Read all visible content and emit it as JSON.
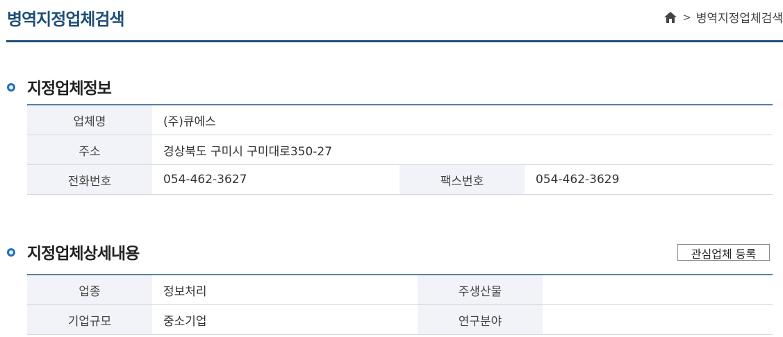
{
  "header": {
    "title": "병역지정업체검색",
    "breadcrumb": {
      "home_icon": "home-icon",
      "separator": ">",
      "current": "병역지정업체검색"
    }
  },
  "colors": {
    "brand": "#1f4e79",
    "label_bg": "#f1f3f8",
    "border": "#d5d9de"
  },
  "info_section": {
    "title": "지정업체정보",
    "company_label": "업체명",
    "company_value": "(주)큐에스",
    "address_label": "주소",
    "address_value": "경상북도 구미시 구미대로350-27",
    "phone_label": "전화번호",
    "phone_value": "054-462-3627",
    "fax_label": "팩스번호",
    "fax_value": "054-462-3629"
  },
  "detail_section": {
    "title": "지정업체상세내용",
    "watch_button": "관심업체 등록",
    "industry_label": "업종",
    "industry_value": "정보처리",
    "product_label": "주생산물",
    "product_value": "",
    "size_label": "기업규모",
    "size_value": "중소기업",
    "research_label": "연구분야",
    "research_value": ""
  }
}
